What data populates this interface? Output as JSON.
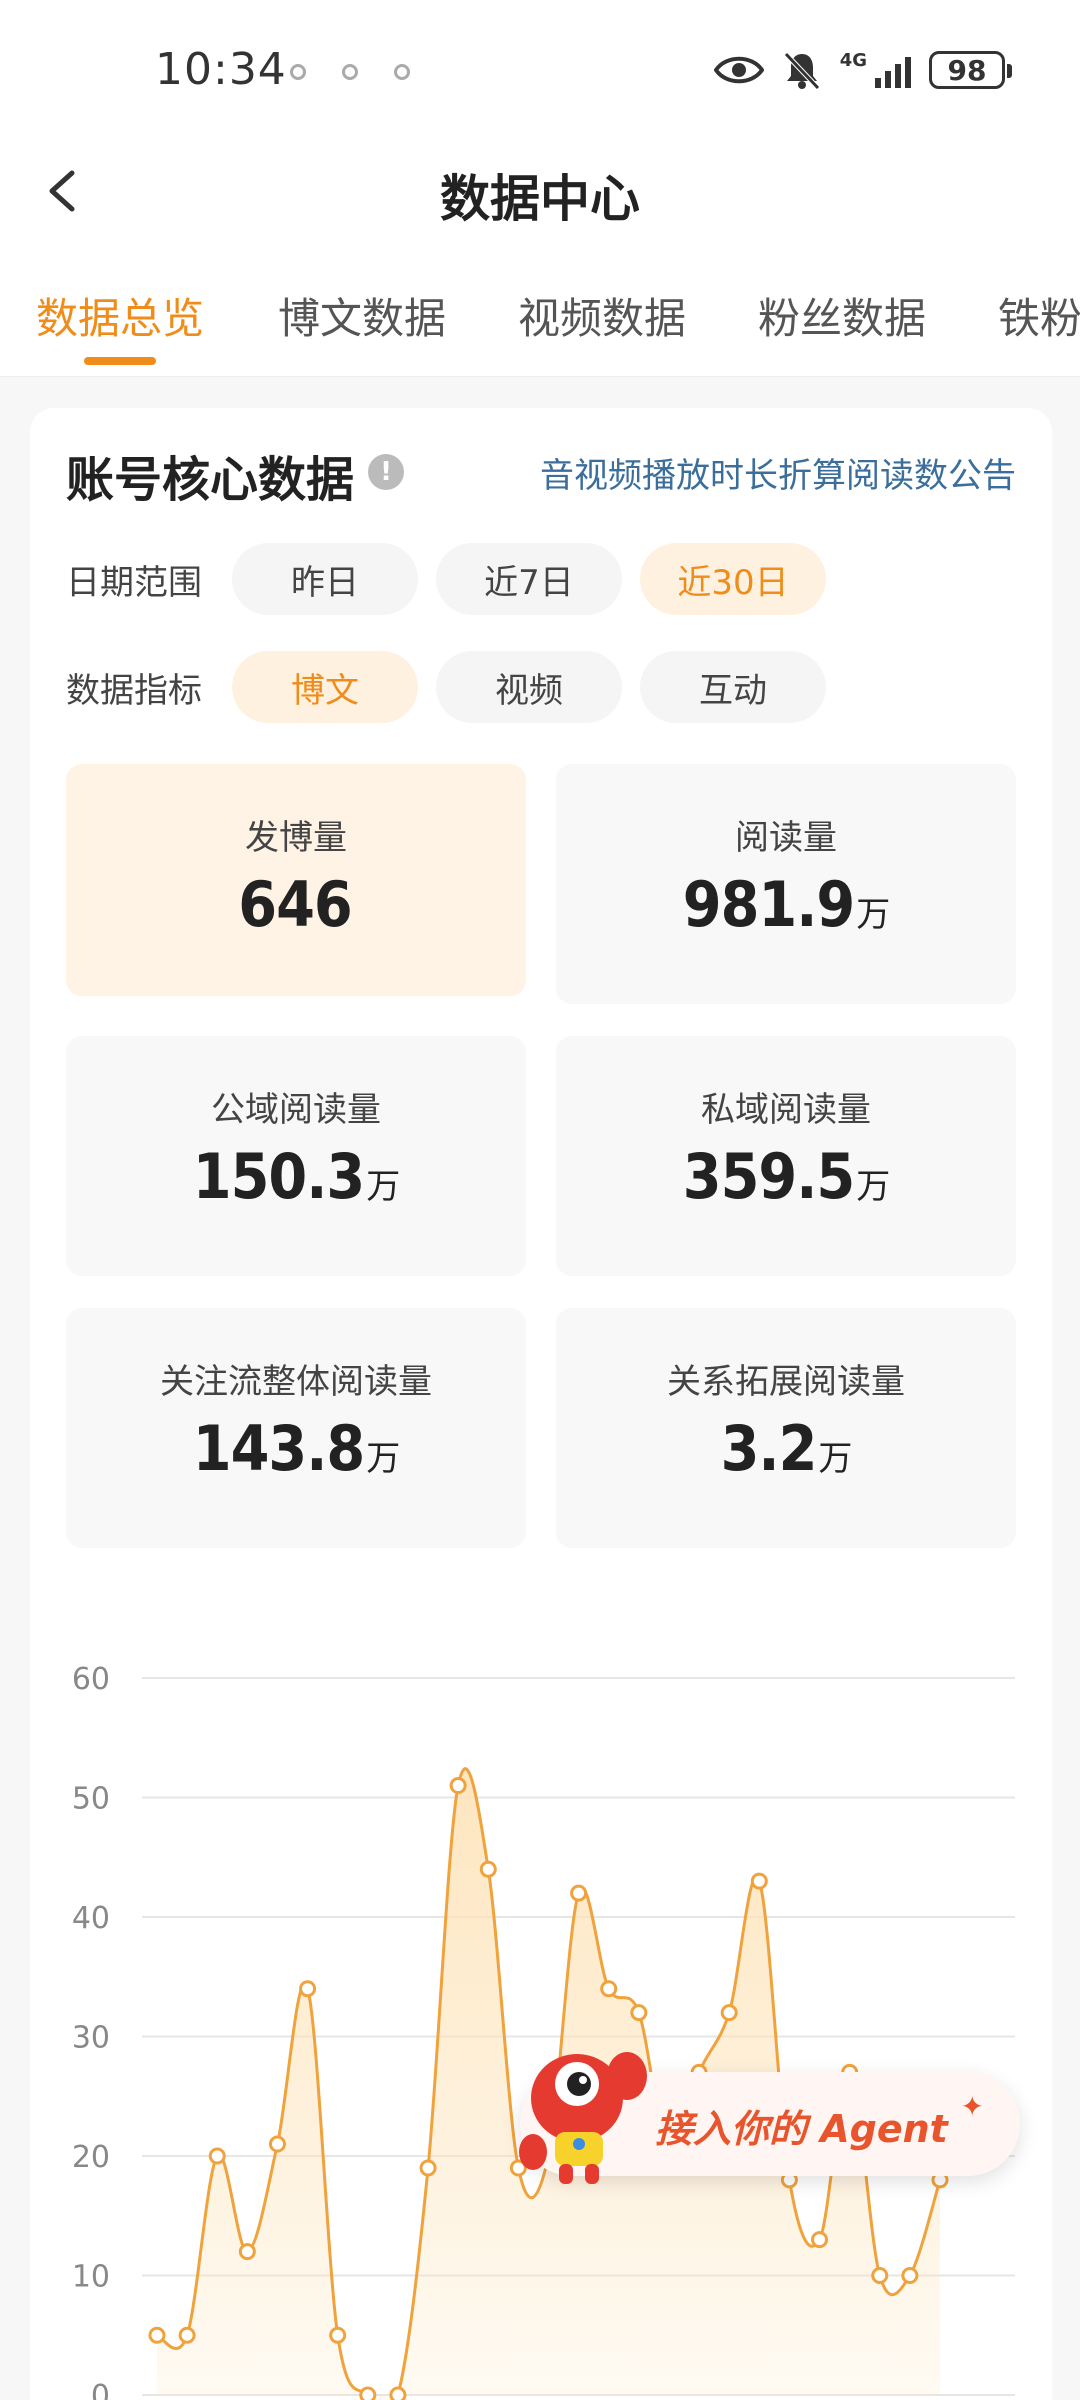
{
  "status_bar": {
    "time": "10:34",
    "network": "4G",
    "battery": "98"
  },
  "header": {
    "title": "数据中心"
  },
  "tabs": [
    {
      "label": "数据总览",
      "active": true
    },
    {
      "label": "博文数据"
    },
    {
      "label": "视频数据"
    },
    {
      "label": "粉丝数据"
    },
    {
      "label": "铁粉"
    }
  ],
  "section": {
    "title": "账号核心数据",
    "notice_link": "音视频播放时长折算阅读数公告"
  },
  "date_range": {
    "label": "日期范围",
    "options": [
      "昨日",
      "近7日",
      "近30日"
    ],
    "selected": "近30日"
  },
  "metric_type": {
    "label": "数据指标",
    "options": [
      "博文",
      "视频",
      "互动"
    ],
    "selected": "博文"
  },
  "stats": [
    {
      "label": "发博量",
      "value": "646",
      "unit": "",
      "active": true
    },
    {
      "label": "阅读量",
      "value": "981.9",
      "unit": "万"
    },
    {
      "label": "公域阅读量",
      "value": "150.3",
      "unit": "万"
    },
    {
      "label": "私域阅读量",
      "value": "359.5",
      "unit": "万"
    },
    {
      "label": "关注流整体阅读量",
      "value": "143.8",
      "unit": "万"
    },
    {
      "label": "关系拓展阅读量",
      "value": "3.2",
      "unit": "万"
    }
  ],
  "chart_data": {
    "type": "area",
    "ylim": [
      0,
      60
    ],
    "yticks": [
      "0",
      "10",
      "20",
      "30",
      "40",
      "50",
      "60"
    ],
    "values": [
      5,
      5,
      20,
      12,
      21,
      34,
      5,
      0,
      0,
      19,
      51,
      44,
      19,
      20,
      42,
      34,
      32,
      20,
      27,
      32,
      43,
      18,
      13,
      27,
      10,
      10,
      18
    ],
    "line_color": "#f0a23c",
    "fill_color": "#fde3b8"
  },
  "agent_button": {
    "label": "接入你的 Agent"
  },
  "colors": {
    "accent": "#f08c1a",
    "link": "#3c6e9b"
  }
}
